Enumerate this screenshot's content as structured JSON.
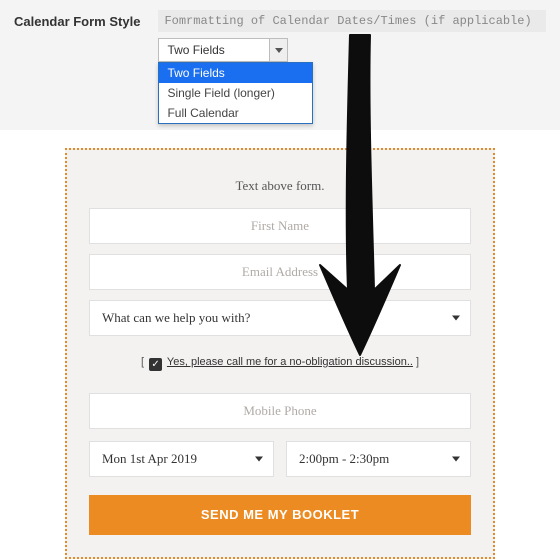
{
  "setting": {
    "label": "Calendar Form Style",
    "hint": "Fomrmatting of Calendar Dates/Times (if applicable)",
    "selected": "Two Fields",
    "options": [
      "Two Fields",
      "Single Field (longer)",
      "Full Calendar"
    ]
  },
  "form": {
    "text_above": "Text above form.",
    "first_name_placeholder": "First Name",
    "email_placeholder": "Email Address",
    "help_select": "What can we help you with?",
    "consent_text": "Yes, please call me for a no-obligation discussion..",
    "phone_placeholder": "Mobile Phone",
    "date_value": "Mon 1st Apr 2019",
    "time_value": "2:00pm - 2:30pm",
    "submit_label": "SEND ME MY BOOKLET"
  }
}
